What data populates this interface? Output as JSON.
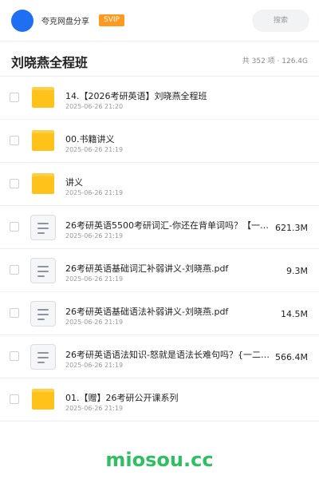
{
  "header": {
    "brand": "夸克网盘分享",
    "badge": "SVIP",
    "search_placeholder": "搜索"
  },
  "folder": {
    "title": "刘晓燕全程班",
    "meta": "共 352 项 · 126.4G"
  },
  "files": [
    {
      "type": "folder-icon",
      "name": "14.【2026考研英语】刘晓燕全程班",
      "date": "2025-06-26 21:20",
      "size": ""
    },
    {
      "type": "folder-icon",
      "name": "00.书籍讲义",
      "date": "2025-06-26 21:19",
      "size": ""
    },
    {
      "type": "folder-icon",
      "name": "讲义",
      "date": "2025-06-26 21:19",
      "size": ""
    },
    {
      "type": "doc-icon",
      "name": "26考研英语5500考研词汇-你还在背单词吗？【一…",
      "date": "2025-06-26 21:19",
      "size": "621.3M"
    },
    {
      "type": "doc-icon",
      "name": "26考研英语基础词汇补弱讲义-刘晓燕.pdf",
      "date": "2025-06-26 21:19",
      "size": "9.3M"
    },
    {
      "type": "doc-icon",
      "name": "26考研英语基础语法补弱讲义-刘晓燕.pdf",
      "date": "2025-06-26 21:19",
      "size": "14.5M"
    },
    {
      "type": "doc-icon",
      "name": "26考研英语语法知识-怒就是语法长难句吗？{一二通…",
      "date": "2025-06-26 21:19",
      "size": "566.4M"
    },
    {
      "type": "folder-icon",
      "name": "01.【赠】26考研公开课系列",
      "date": "2025-06-26 21:19",
      "size": ""
    }
  ],
  "watermark": "miosou.cc",
  "colors": {
    "avatar": "#1f6ff2",
    "badge": "#ff9a1f",
    "folder": "#ffc21a",
    "watermark": "#2fbf62"
  }
}
